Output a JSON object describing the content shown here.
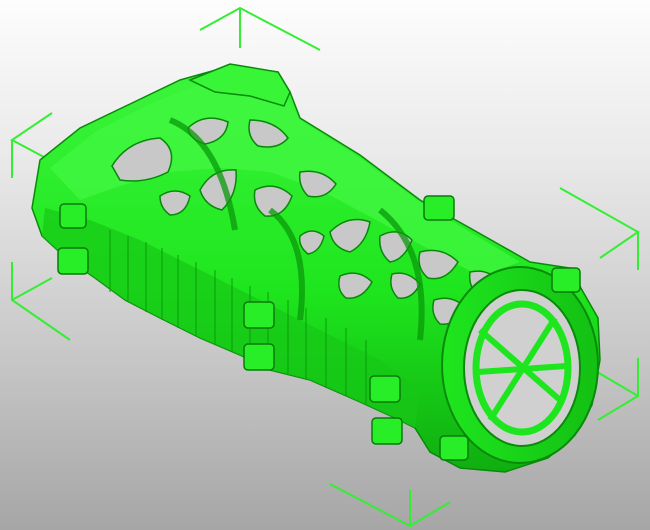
{
  "viewport": {
    "background_top": "#fdfdfd",
    "background_bottom": "#a6a6a6"
  },
  "model": {
    "color": "#1ee61e",
    "highlight": "#4cff4c",
    "shade": "#0c8f0c",
    "dark": "#075507"
  },
  "bounding_box": {
    "color": "#33ee33",
    "icon": "bounding-box-corner-marker"
  }
}
